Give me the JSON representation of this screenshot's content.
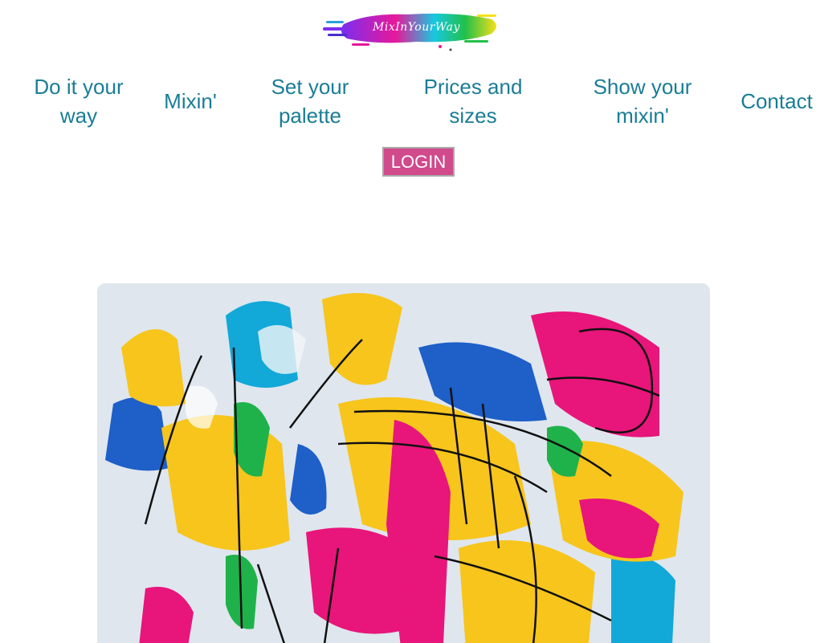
{
  "logo": {
    "text": "MixInYourWay",
    "colors": [
      "#7a2ff0",
      "#e8189a",
      "#18c8e0",
      "#f5e018",
      "#22c04a"
    ]
  },
  "nav": {
    "items": [
      {
        "line1": "Do it your",
        "line2": "way"
      },
      {
        "line1": "Mixin'",
        "line2": ""
      },
      {
        "line1": "Set your",
        "line2": "palette"
      },
      {
        "line1": "Prices and",
        "line2": "sizes"
      },
      {
        "line1": "Show your",
        "line2": "mixin'"
      },
      {
        "line1": "Contact",
        "line2": ""
      }
    ],
    "color": "#1a7d96"
  },
  "login": {
    "label": "LOGIN",
    "color": "#d04a8c"
  },
  "hero": {
    "icon": "abstract-paint-image",
    "colors": [
      "#f7c51c",
      "#1e5fc8",
      "#e8157a",
      "#12a8d8",
      "#1fb24a",
      "#111111"
    ]
  }
}
